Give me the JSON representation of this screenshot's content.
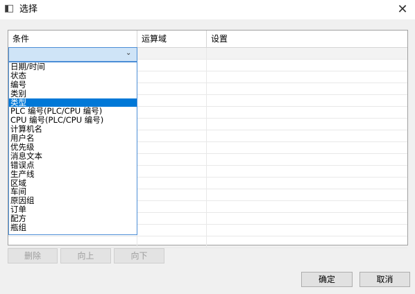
{
  "window": {
    "title": "选择",
    "close_glyph": "✕"
  },
  "table": {
    "columns": [
      "条件",
      "运算域",
      "设置"
    ]
  },
  "condition_combo": {
    "value": "",
    "arrow_glyph": "⌄"
  },
  "dropdown": {
    "items": [
      "日期/时间",
      "状态",
      "编号",
      "类别",
      "类型",
      "PLC 编号(PLC/CPU 编号)",
      "CPU 编号(PLC/CPU 编号)",
      "计算机名",
      "用户名",
      "优先级",
      "消息文本",
      "错误点",
      "生产线",
      "区域",
      "车间",
      "原因组",
      "订单",
      "配方",
      "瓶组"
    ],
    "highlighted_index": 4
  },
  "row_buttons": {
    "delete": "删除",
    "up": "向上",
    "down": "向下"
  },
  "dialog_buttons": {
    "ok": "确定",
    "cancel": "取消"
  }
}
